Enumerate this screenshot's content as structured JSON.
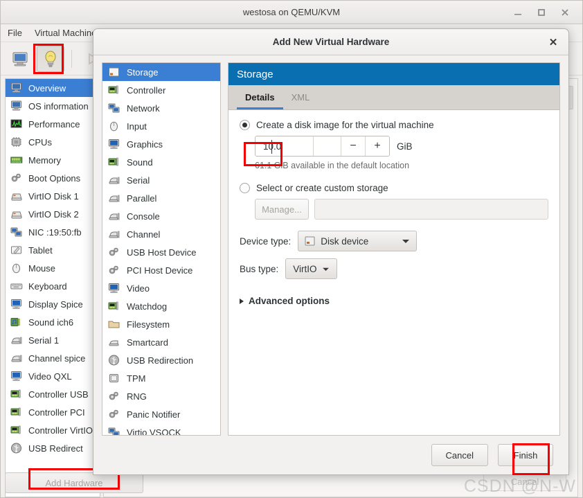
{
  "window": {
    "title": "westosa on QEMU/KVM",
    "controls": {
      "minimize": "minimize-icon",
      "maximize": "maximize-icon",
      "close": "close-icon"
    },
    "menus": [
      "File",
      "Virtual Machine"
    ],
    "toolbar": [
      {
        "name": "show-console-button",
        "icon": "monitor-icon"
      },
      {
        "name": "show-details-button",
        "icon": "lightbulb-icon",
        "pressed": true
      },
      {
        "name": "run-button",
        "icon": "play-icon"
      }
    ],
    "sidebar": {
      "items": [
        {
          "label": "Overview",
          "icon": "monitor-icon",
          "selected": true
        },
        {
          "label": "OS information",
          "icon": "monitor-icon"
        },
        {
          "label": "Performance",
          "icon": "graph-icon"
        },
        {
          "label": "CPUs",
          "icon": "cpu-icon"
        },
        {
          "label": "Memory",
          "icon": "memory-icon"
        },
        {
          "label": "Boot Options",
          "icon": "gears-icon"
        },
        {
          "label": "VirtIO Disk 1",
          "icon": "disk-icon"
        },
        {
          "label": "VirtIO Disk 2",
          "icon": "disk-icon"
        },
        {
          "label": "NIC :19:50:fb",
          "icon": "network-icon"
        },
        {
          "label": "Tablet",
          "icon": "tablet-icon"
        },
        {
          "label": "Mouse",
          "icon": "mouse-icon"
        },
        {
          "label": "Keyboard",
          "icon": "keyboard-icon"
        },
        {
          "label": "Display Spice",
          "icon": "display-icon"
        },
        {
          "label": "Sound ich6",
          "icon": "sound-icon"
        },
        {
          "label": "Serial 1",
          "icon": "serial-icon"
        },
        {
          "label": "Channel spice",
          "icon": "serial-icon"
        },
        {
          "label": "Video QXL",
          "icon": "display-icon"
        },
        {
          "label": "Controller USB",
          "icon": "controller-icon"
        },
        {
          "label": "Controller PCI",
          "icon": "controller-icon"
        },
        {
          "label": "Controller VirtIO",
          "icon": "controller-icon"
        },
        {
          "label": "USB Redirect",
          "icon": "usb-icon"
        }
      ]
    },
    "add_hardware_button": "Add Hardware",
    "ghost_cancel_button": "Cancel"
  },
  "dialog": {
    "title": "Add New Virtual Hardware",
    "close_label": "✕",
    "hardware_types": [
      {
        "label": "Storage",
        "icon": "storage-icon",
        "selected": true
      },
      {
        "label": "Controller",
        "icon": "controller-icon"
      },
      {
        "label": "Network",
        "icon": "network-icon"
      },
      {
        "label": "Input",
        "icon": "mouse-icon"
      },
      {
        "label": "Graphics",
        "icon": "display-icon"
      },
      {
        "label": "Sound",
        "icon": "soundcard-icon"
      },
      {
        "label": "Serial",
        "icon": "serial-icon"
      },
      {
        "label": "Parallel",
        "icon": "serial-icon"
      },
      {
        "label": "Console",
        "icon": "serial-icon"
      },
      {
        "label": "Channel",
        "icon": "serial-icon"
      },
      {
        "label": "USB Host Device",
        "icon": "gears-icon"
      },
      {
        "label": "PCI Host Device",
        "icon": "gears-icon"
      },
      {
        "label": "Video",
        "icon": "display-icon"
      },
      {
        "label": "Watchdog",
        "icon": "controller-icon"
      },
      {
        "label": "Filesystem",
        "icon": "folder-icon"
      },
      {
        "label": "Smartcard",
        "icon": "smartcard-icon"
      },
      {
        "label": "USB Redirection",
        "icon": "usb-icon"
      },
      {
        "label": "TPM",
        "icon": "chip-icon"
      },
      {
        "label": "RNG",
        "icon": "gears-icon"
      },
      {
        "label": "Panic Notifier",
        "icon": "gears-icon"
      },
      {
        "label": "Virtio VSOCK",
        "icon": "network-icon"
      }
    ],
    "panel": {
      "header": "Storage",
      "tabs": [
        {
          "label": "Details",
          "active": true
        },
        {
          "label": "XML",
          "active": false
        }
      ],
      "create_disk": {
        "label": "Create a disk image for the virtual machine",
        "selected": true,
        "size_value": "10.0",
        "size_unit": "GiB",
        "decrement_label": "−",
        "increment_label": "+",
        "available_text": "61.1 GiB available in the default location"
      },
      "custom_storage": {
        "label": "Select or create custom storage",
        "selected": false,
        "manage_button": "Manage...",
        "path_value": ""
      },
      "device_type": {
        "label": "Device type:",
        "value": "Disk device",
        "icon": "disk-device-icon"
      },
      "bus_type": {
        "label": "Bus type:",
        "value": "VirtIO"
      },
      "advanced_options": "Advanced options"
    },
    "footer": {
      "cancel": "Cancel",
      "finish": "Finish"
    }
  },
  "watermark": "CSDN @N-W",
  "colors": {
    "panel_header_blue": "#0a6fb0",
    "selection_blue": "#3b7fd4",
    "highlight_red": "#f40000",
    "window_bg": "#f0efee"
  }
}
